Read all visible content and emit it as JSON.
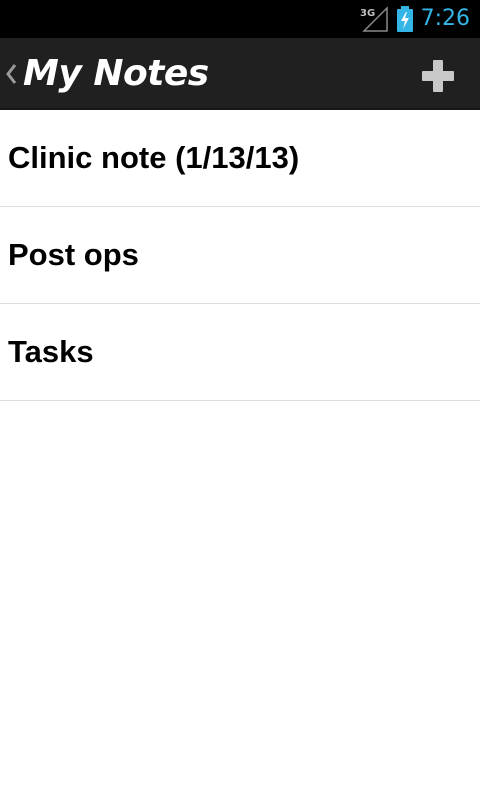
{
  "status_bar": {
    "network_type": "3G",
    "time": "7:26",
    "signal_icon": "signal-3g-icon",
    "battery_icon": "battery-charging-icon",
    "clock_color": "#33b5e5"
  },
  "action_bar": {
    "title": "My Notes",
    "up_icon": "chevron-left-icon",
    "add_icon": "plus-icon",
    "background": "#202020"
  },
  "notes": [
    {
      "label": "Clinic note (1/13/13)"
    },
    {
      "label": "Post ops"
    },
    {
      "label": "Tasks"
    }
  ]
}
